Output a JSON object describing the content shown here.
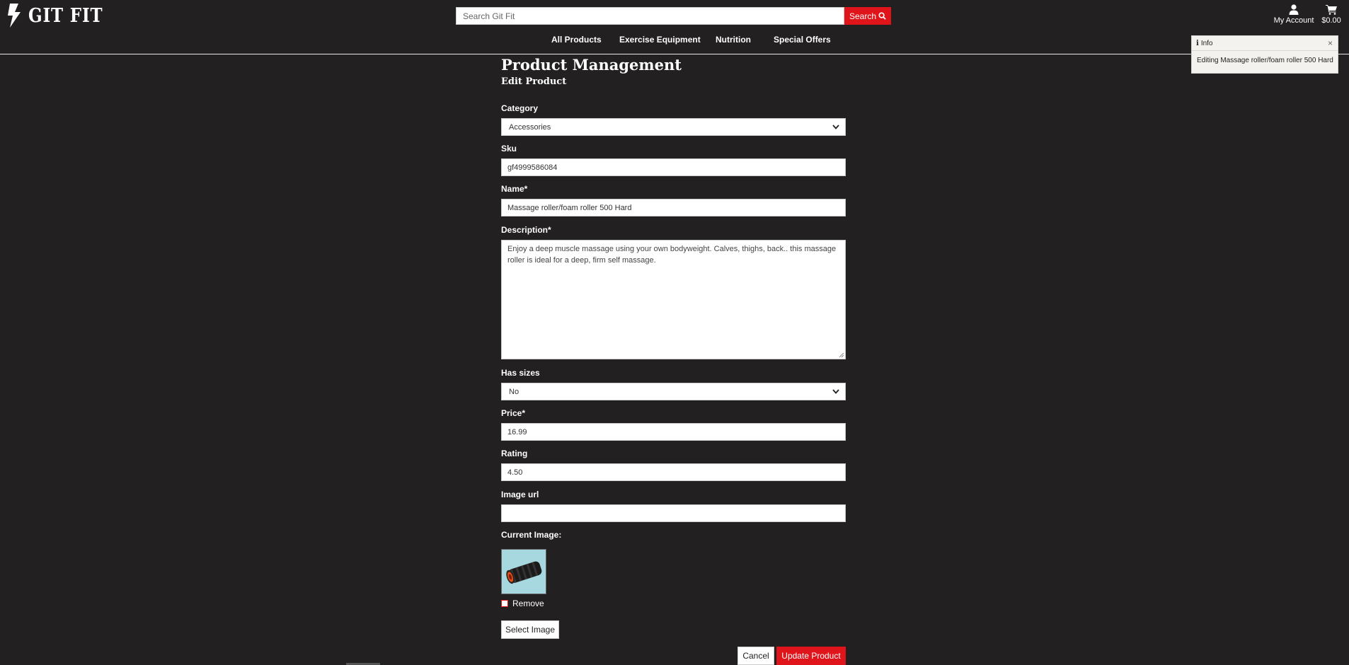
{
  "brand": {
    "name": "GIT FIT"
  },
  "search": {
    "placeholder": "Search Git Fit",
    "button_label": "Search"
  },
  "account": {
    "label": "My Account"
  },
  "cart": {
    "total": "$0.00"
  },
  "nav": {
    "items": [
      {
        "label": "All Products"
      },
      {
        "label": "Exercise Equipment"
      },
      {
        "label": "Nutrition"
      },
      {
        "label": "Special Offers"
      }
    ]
  },
  "toast": {
    "title": "Info",
    "message": "Editing Massage roller/foam roller 500 Hard",
    "close_glyph": "×"
  },
  "page": {
    "title": "Product Management",
    "subtitle": "Edit Product"
  },
  "form": {
    "category": {
      "label": "Category",
      "value": "Accessories"
    },
    "sku": {
      "label": "Sku",
      "value": "gf4999586084"
    },
    "name": {
      "label": "Name*",
      "value": "Massage roller/foam roller 500 Hard"
    },
    "description": {
      "label": "Description*",
      "value": "Enjoy a deep muscle massage using  your own bodyweight. Calves, thighs, back.. this massage roller is ideal for a deep, firm self massage."
    },
    "has_sizes": {
      "label": "Has sizes",
      "value": "No"
    },
    "price": {
      "label": "Price*",
      "value": "16.99"
    },
    "rating": {
      "label": "Rating",
      "value": "4.50"
    },
    "image_url": {
      "label": "Image url",
      "value": ""
    },
    "current_image": {
      "label": "Current Image:"
    },
    "remove": {
      "label": "Remove",
      "checked": false
    },
    "select_image_label": "Select Image",
    "cancel_label": "Cancel",
    "update_label": "Update Product"
  },
  "colors": {
    "background": "#222020",
    "accent": "#e0141b",
    "text": "#ffffff",
    "toast_bg": "#f4f2ee"
  }
}
